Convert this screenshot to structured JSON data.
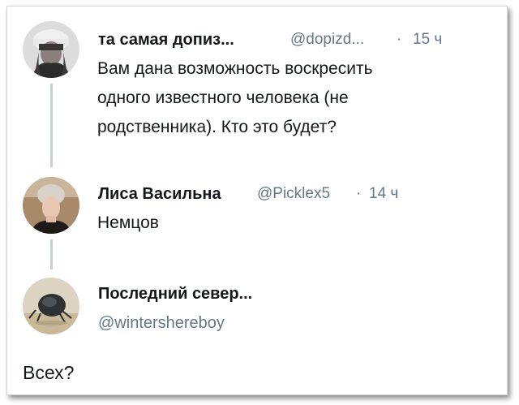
{
  "tweets": [
    {
      "name": "та самая допиз...",
      "handle": "@dopizd...",
      "sep": "·",
      "time": "15 ч",
      "text_lines": [
        "Вам дана возможность воскресить",
        "одного известного человека (не",
        "родственника). Кто это будет?"
      ]
    },
    {
      "name": "Лиса Васильна",
      "handle": "@Picklex5",
      "sep": "·",
      "time": "14 ч",
      "text_lines": [
        "Немцов"
      ]
    },
    {
      "name": "Последний север...",
      "handle": "@wintershereboy",
      "text_lines": [
        "Всех?"
      ]
    }
  ],
  "colors": {
    "text": "#14171a",
    "secondary": "#657786",
    "thread_line": "#c4cfd6"
  }
}
